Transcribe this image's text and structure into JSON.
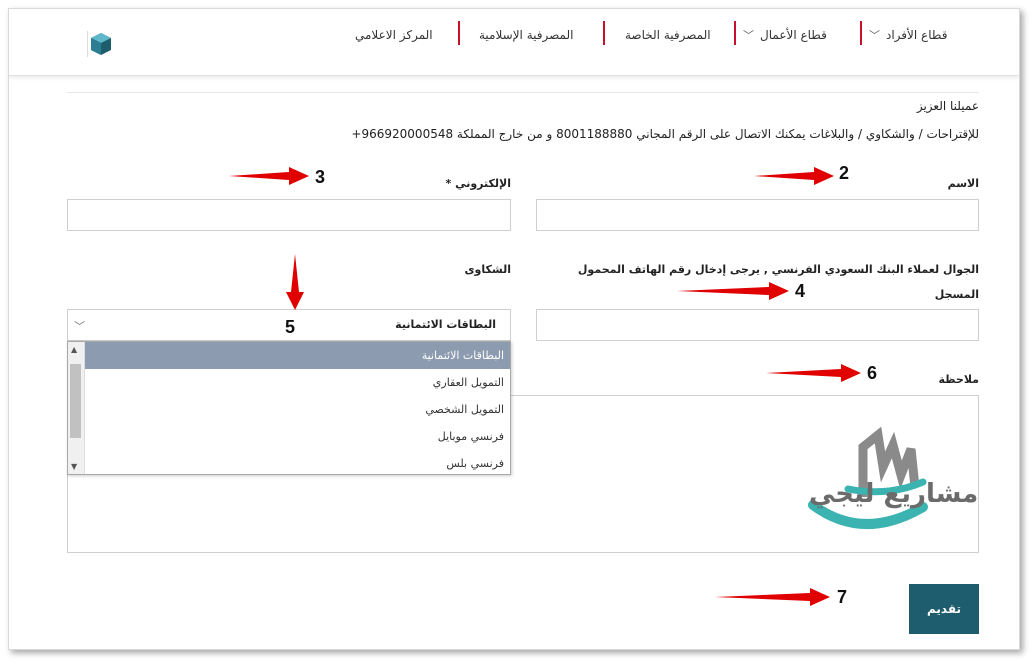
{
  "nav": {
    "items": [
      {
        "label": "قطاع الأفراد",
        "dropdown": true
      },
      {
        "label": "قطاع الأعمال",
        "dropdown": true
      },
      {
        "label": "المصرفية الخاصة",
        "dropdown": false
      },
      {
        "label": "المصرفية الإسلامية",
        "dropdown": false
      },
      {
        "label": "المركز الاعلامي",
        "dropdown": false
      }
    ],
    "accent_color": "#c8102e"
  },
  "intro": {
    "greeting": "عميلنا العزيز",
    "contact_text": "للإقتراحات / والشكاوي / والبلاغات يمكنك الاتصال على الرقم المجاني 8001188880 و من خارج المملكة 966920000548+"
  },
  "form": {
    "name_label": "الاسم",
    "email_label": "الإلكتروني *",
    "mobile_label_line1": "الجوال لعملاء البنك السعودي الفرنسي , يرجى إدخال رقم الهاتف المحمول",
    "mobile_label_line2": "المسجل",
    "complaints_label": "الشكاوى",
    "complaints_selected": "البطاقات الائتمانية",
    "complaints_options": [
      "البطاقات الائتمانية",
      "التمويل العقاري",
      "التمويل الشخصي",
      "فرنسي موبايل",
      "فرنسي بلس"
    ],
    "note_label": "ملاحظة",
    "submit_label": "تقديم",
    "submit_color": "#1e5d6e"
  },
  "annotations": {
    "markers": [
      "2",
      "3",
      "4",
      "5",
      "6",
      "7"
    ],
    "arrow_color": "#e00000"
  },
  "watermark": {
    "text": "مشاريع ليجي"
  }
}
